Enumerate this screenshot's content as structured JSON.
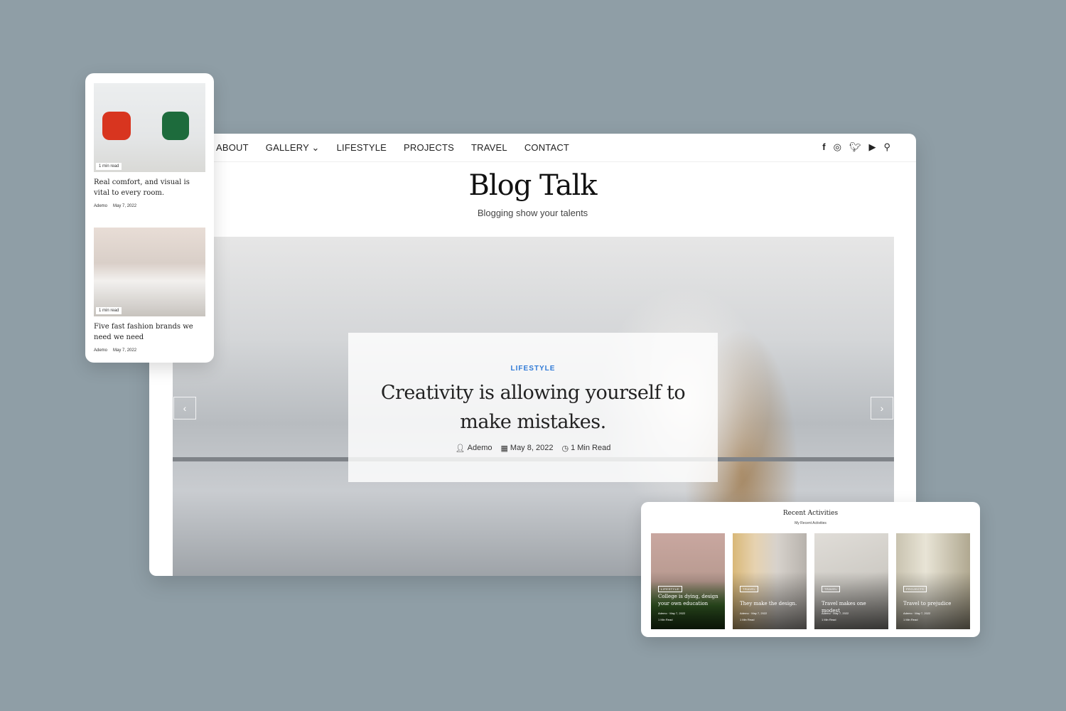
{
  "nav": {
    "items": [
      "ABOUT",
      "GALLERY ⌄",
      "LIFESTYLE",
      "PROJECTS",
      "TRAVEL",
      "CONTACT"
    ]
  },
  "social": [
    "facebook-icon",
    "instagram-icon",
    "twitter-icon",
    "youtube-icon",
    "search-icon"
  ],
  "site": {
    "title": "Blog Talk",
    "tagline": "Blogging show your talents"
  },
  "hero": {
    "category": "LIFESTYLE",
    "title": "Creativity is allowing yourself to make mistakes.",
    "author": "Ademo",
    "date": "May 8, 2022",
    "read": "1 Min Read",
    "prev": "‹",
    "next": "›"
  },
  "mobile": {
    "posts": [
      {
        "badge": "1 min read",
        "title": "Real comfort, and visual is vital to every room.",
        "author": "Ademo",
        "date": "May 7, 2022"
      },
      {
        "badge": "1 min read",
        "title": "Five fast fashion brands we need we need",
        "author": "Ademo",
        "date": "May 7, 2022"
      }
    ]
  },
  "recent": {
    "heading": "Recent Activities",
    "subheading": "My Recent Activities",
    "cards": [
      {
        "category": "LIFESTYLE",
        "title": "College is dying, design your own education",
        "author": "Ademo",
        "date": "May 7, 2022",
        "read": "1 Min Read"
      },
      {
        "category": "TRAVEL",
        "title": "They make the design.",
        "author": "Ademo",
        "date": "May 7, 2022",
        "read": "1 Min Read"
      },
      {
        "category": "TRAVEL",
        "title": "Travel makes one modest",
        "author": "Ademo",
        "date": "May 7, 2022",
        "read": "1 Min Read"
      },
      {
        "category": "PROJECTS",
        "title": "Travel to prejudice",
        "author": "Ademo",
        "date": "May 7, 2022",
        "read": "1 Min Read"
      }
    ]
  },
  "colors": {
    "background": "#8f9ea6",
    "accent": "#2f7ad6"
  }
}
